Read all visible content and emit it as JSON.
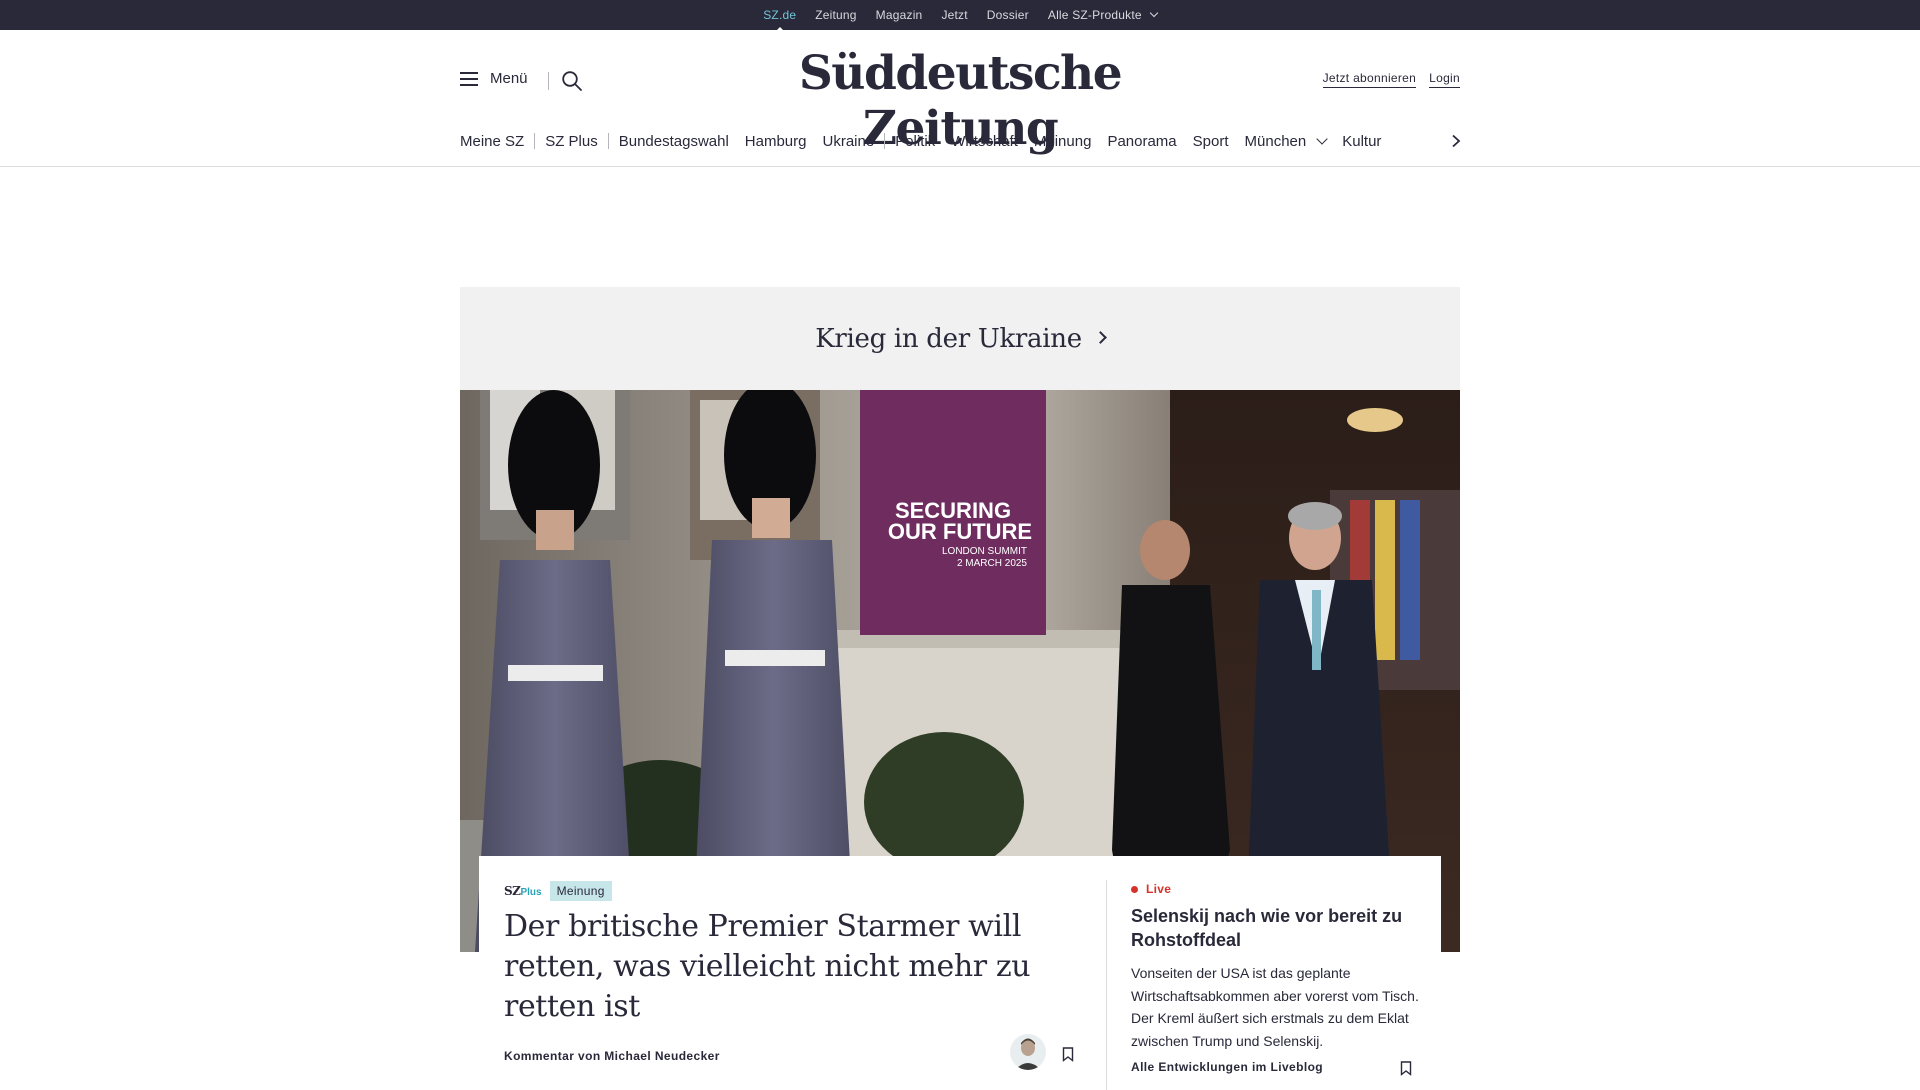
{
  "topbar": {
    "items": [
      "SZ.de",
      "Zeitung",
      "Magazin",
      "Jetzt",
      "Dossier",
      "Alle SZ-Produkte"
    ],
    "active_index": 0,
    "accent_color": "#71c5d6"
  },
  "header": {
    "menu_label": "Menü",
    "logo_text": "Süddeutsche Zeitung",
    "subscribe_label": "Jetzt abonnieren",
    "login_label": "Login"
  },
  "nav": {
    "items": [
      "Meine SZ",
      "SZ Plus",
      "Bundestagswahl",
      "Hamburg",
      "Ukraine",
      "Politik",
      "Wirtschaft",
      "Meinung",
      "Panorama",
      "Sport",
      "München",
      "Kultur"
    ]
  },
  "dossier": {
    "title": "Krieg in der Ukraine"
  },
  "hero": {
    "banner_line1": "SECURING",
    "banner_line2": "OUR FUTURE",
    "banner_line3": "LONDON SUMMIT",
    "banner_line4": "2 MARCH 2025"
  },
  "main_teaser": {
    "brand_sz": "SZ",
    "brand_plus": "Plus",
    "tag": "Meinung",
    "headline": "Der britische Premier Starmer will retten, was vielleicht nicht mehr zu retten ist",
    "author": "Kommentar von Michael Neudecker"
  },
  "side_teaser": {
    "live_label": "Live",
    "headline": "Selenskij nach wie vor bereit zu Rohstoffdeal",
    "text": "Vonseiten der USA ist das geplante Wirtschaftsabkommen aber vorerst vom Tisch. Der Kreml äußert sich erstmals zu dem Eklat zwischen Trump und Selenskij.",
    "link": "Alle Entwicklungen im Liveblog",
    "live_color": "#d6322a"
  }
}
